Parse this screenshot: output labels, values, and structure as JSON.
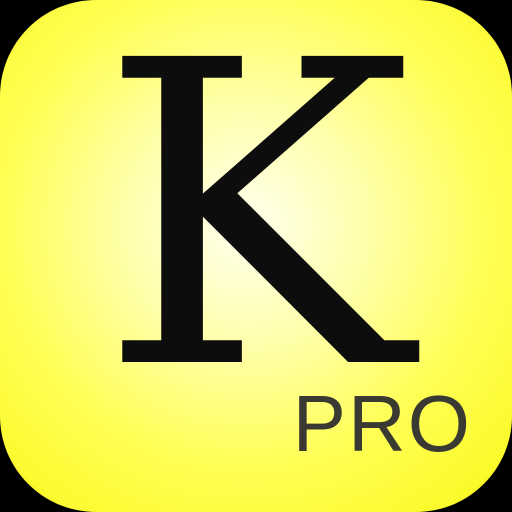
{
  "app_icon": {
    "letter": "K",
    "badge": "PRO"
  },
  "colors": {
    "background_outer": "#000000",
    "icon_center": "#fffff0",
    "icon_edge": "#f9f718",
    "letter": "#0d0d0d",
    "badge_text": "#3a3a32"
  }
}
